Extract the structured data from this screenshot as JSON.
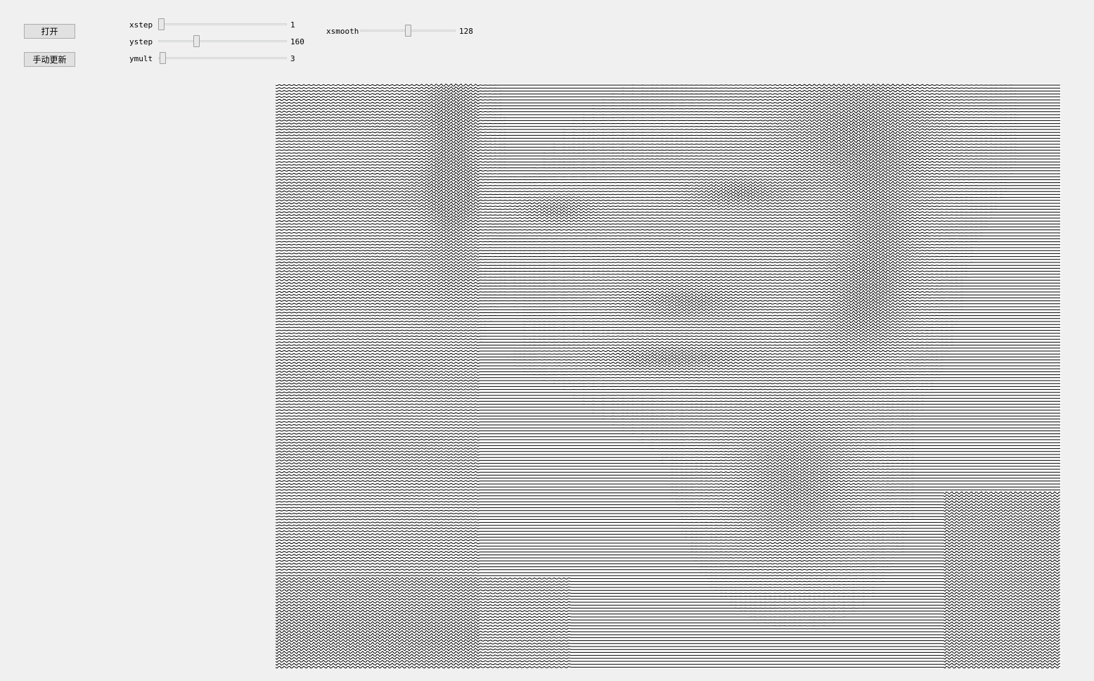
{
  "buttons": {
    "open": "打开",
    "manual_update": "手动更新"
  },
  "sliders": {
    "xstep": {
      "label": "xstep",
      "value": "1",
      "position": 0.0
    },
    "ystep": {
      "label": "ystep",
      "value": "160",
      "position": 0.29
    },
    "ymult": {
      "label": "ymult",
      "value": "3",
      "position": 0.01
    },
    "xsmooth": {
      "label": "xsmooth",
      "value": "128",
      "position": 0.5
    }
  },
  "canvas": {
    "description_icon": "wave-line-portrait-image"
  }
}
